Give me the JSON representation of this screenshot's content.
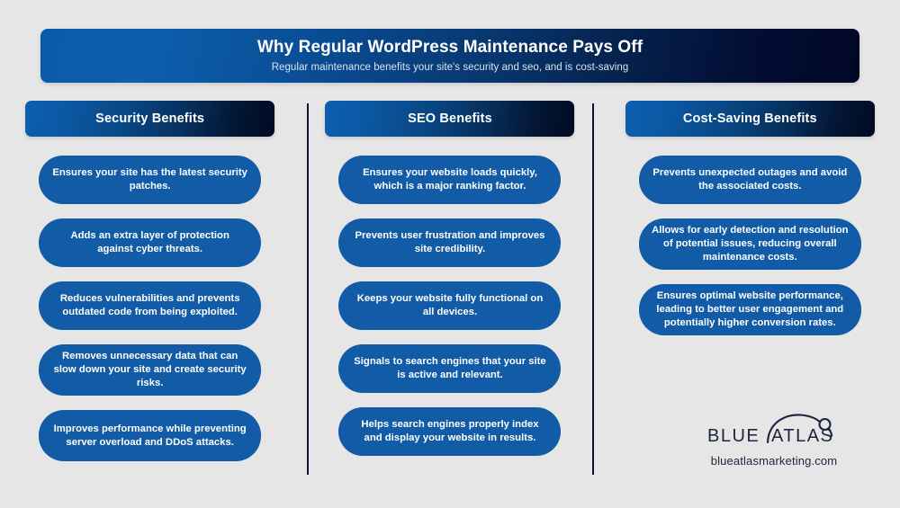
{
  "page": {
    "background_color": "#e6e6e6",
    "accent_blue": "#125ba6",
    "dark_navy": "#010a22",
    "divider_color": "#071436"
  },
  "header": {
    "title": "Why Regular WordPress Maintenance Pays Off",
    "subtitle": "Regular maintenance benefits your site's security and seo, and is cost-saving"
  },
  "columns": [
    {
      "heading": "Security Benefits",
      "items": [
        "Ensures your site has the latest security patches.",
        "Adds an extra layer of protection against cyber threats.",
        "Reduces vulnerabilities and prevents outdated code from being exploited.",
        "Removes unnecessary data that can slow down your site and create security risks.",
        "Improves performance while preventing server overload and DDoS attacks."
      ]
    },
    {
      "heading": "SEO Benefits",
      "items": [
        "Ensures your website loads quickly, which is a major ranking factor.",
        "Prevents user frustration and improves site credibility.",
        "Keeps your website fully functional on all devices.",
        "Signals to search engines that your site is active and relevant.",
        "Helps search engines properly index and display your website in results."
      ]
    },
    {
      "heading": "Cost-Saving Benefits",
      "items": [
        "Prevents unexpected outages and avoid the associated costs.",
        "Allows for early detection and resolution of potential issues, reducing overall maintenance costs.",
        "Ensures optimal website performance, leading to better user engagement and potentially higher conversion rates."
      ]
    }
  ],
  "footer": {
    "logo_word_one": "BLUE",
    "logo_word_two": "ATLAS",
    "url": "blueatlasmarketing.com"
  }
}
